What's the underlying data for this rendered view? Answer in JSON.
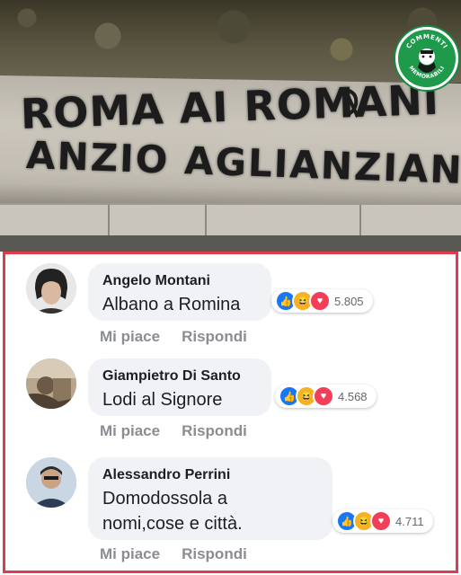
{
  "photo": {
    "graffiti_line1": "ROMA AI ROMANI",
    "graffiti_line2": "ANZIO AGLIANZIANI",
    "badge_top": "COMMENTI",
    "badge_bottom": "MEMORABILI"
  },
  "colors": {
    "frame": "#e03a4d",
    "bubble": "#f0f2f5",
    "like": "#1877f2",
    "haha": "#f7b125",
    "love": "#f33e58",
    "badge": "#1f9a4b"
  },
  "comments": [
    {
      "author": "Angelo Montani",
      "text": "Albano a Romina",
      "reactions": [
        "like-icon",
        "haha-icon",
        "love-icon"
      ],
      "count": "5.805",
      "like_label": "Mi piace",
      "reply_label": "Rispondi"
    },
    {
      "author": "Giampietro Di Santo",
      "text": "Lodi al Signore",
      "reactions": [
        "like-icon",
        "haha-icon",
        "love-icon"
      ],
      "count": "4.568",
      "like_label": "Mi piace",
      "reply_label": "Rispondi"
    },
    {
      "author": "Alessandro Perrini",
      "text_line1": "Domodossola a",
      "text_line2": "nomi,cose e città.",
      "reactions": [
        "like-icon",
        "haha-icon",
        "love-icon"
      ],
      "count": "4.711",
      "like_label": "Mi piace",
      "reply_label": "Rispondi"
    }
  ]
}
